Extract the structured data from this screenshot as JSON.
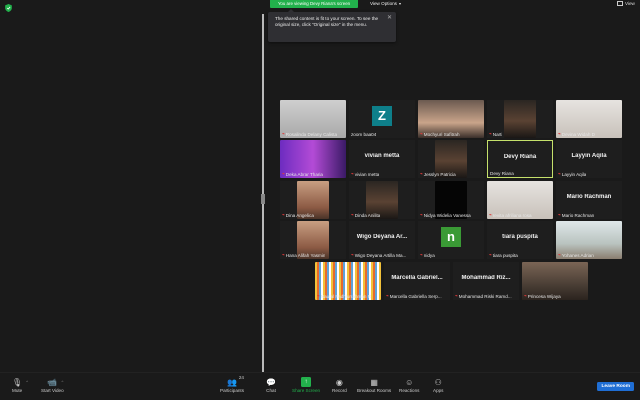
{
  "header": {
    "banner": "You are viewing Devy Riana's screen",
    "view_options": "View Options",
    "view_label": "View"
  },
  "tooltip": {
    "text": "The shared content is fit to your screen. To see the original size, click \"Original size\" in the menu.",
    "close": "✕"
  },
  "participants": [
    {
      "name": "Rosalinda Delany Calista",
      "type": "video",
      "bg": "bg-grey",
      "muted": true
    },
    {
      "name": "zoom baa04",
      "type": "avatar",
      "letter": "Z",
      "color": "#0e7f8a",
      "muted": false
    },
    {
      "name": "Mochyuri Safitrah",
      "type": "video",
      "bg": "bg-skin",
      "muted": true
    },
    {
      "name": "Narti",
      "type": "video",
      "bg": "bg-dark",
      "muted": true
    },
    {
      "name": "Devina Widah D",
      "type": "video",
      "bg": "bg-light",
      "muted": true
    },
    {
      "name": "Deka Abrar Tharia",
      "type": "video",
      "bg": "bg-purple",
      "muted": true
    },
    {
      "name": "vivian metta",
      "type": "name",
      "center": "vivian metta",
      "muted": true
    },
    {
      "name": "Jesslyn Patricia",
      "type": "video",
      "bg": "bg-dark",
      "muted": true
    },
    {
      "name": "Devy Riana",
      "type": "name",
      "center": "Devy Riana",
      "muted": false,
      "active": true
    },
    {
      "name": "Layyin Aqila",
      "type": "name",
      "center": "Layyin Aqila",
      "muted": true
    },
    {
      "name": "Dina Angelica",
      "type": "video",
      "bg": "bg-warm",
      "muted": true
    },
    {
      "name": "Dinda Anilita",
      "type": "video",
      "bg": "bg-dark",
      "muted": true
    },
    {
      "name": "Nidya Widelia Vanessa",
      "type": "video",
      "bg": "bg-black",
      "muted": true
    },
    {
      "name": "revita afriliana rosa",
      "type": "video",
      "bg": "bg-light",
      "muted": true
    },
    {
      "name": "Mario Rachman",
      "type": "name",
      "center": "Mario Rachman",
      "muted": true
    },
    {
      "name": "Hana Alifah Yasmin",
      "type": "video",
      "bg": "bg-warm",
      "muted": true
    },
    {
      "name": "Wigo Deyana Artilla Ma...",
      "type": "name",
      "center": "Wigo Deyana Ar...",
      "muted": true
    },
    {
      "name": "nidya",
      "type": "avatar",
      "letter": "n",
      "color": "#3a9a35",
      "muted": true
    },
    {
      "name": "tiara puspita",
      "type": "name",
      "center": "tiara puspita",
      "muted": true
    },
    {
      "name": "Yohanes Adrian",
      "type": "video",
      "bg": "bg-outdoor",
      "muted": true
    },
    {
      "name": "Naufal Fadhlurrahman R",
      "type": "video",
      "bg": "bg-stripes",
      "muted": true
    },
    {
      "name": "Marcella Gabriella Serp...",
      "type": "name",
      "center": "Marcella Gabriel...",
      "muted": true
    },
    {
      "name": "Mohammad Riski Ramd...",
      "type": "name",
      "center": "Mohammad Riz...",
      "muted": true
    },
    {
      "name": "Princesa Wijaya",
      "type": "video",
      "bg": "bg-room",
      "muted": true
    }
  ],
  "toolbar": {
    "mute": "Mute",
    "start_video": "Start Video",
    "participants": "Participants",
    "participants_count": "24",
    "chat": "Chat",
    "share_screen": "Share Screen",
    "record": "Record",
    "breakout_rooms": "Breakout Rooms",
    "reactions": "Reactions",
    "apps": "Apps",
    "leave": "Leave Room"
  },
  "colors": {
    "share_green": "#22b14c",
    "leave_blue": "#1f6ed4",
    "active_speaker": "#c5e16b",
    "muted_red": "#e03a3a"
  }
}
